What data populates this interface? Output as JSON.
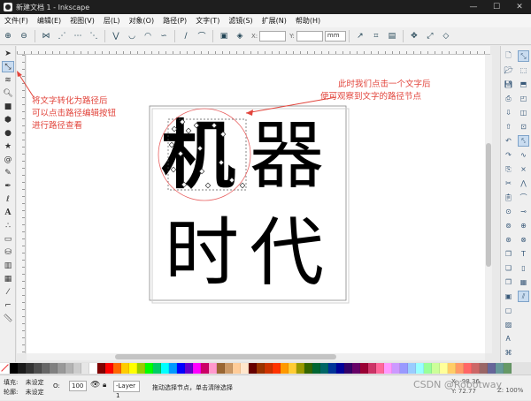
{
  "title": "新建文档 1 - Inkscape",
  "menus": [
    "文件(F)",
    "编辑(E)",
    "视图(V)",
    "层(L)",
    "对象(O)",
    "路径(P)",
    "文字(T)",
    "滤镜(S)",
    "扩展(N)",
    "帮助(H)"
  ],
  "controls": {
    "x_label": "X:",
    "y_label": "Y:",
    "x_value": "",
    "y_value": "",
    "unit": "mm"
  },
  "canvas": {
    "row1_char1": "机",
    "row1_char2": "器",
    "row2_char1": "时",
    "row2_char2": "代"
  },
  "annotations": {
    "left_note_line1": "将文字转化为路径后",
    "left_note_line2": "可以点击路径编辑按钮",
    "left_note_line3": "进行路径查看",
    "right_note_line1": "此时我们点击一个文字后",
    "right_note_line2": "便可观察到文字的路径节点",
    "accent_color": "#e2453c"
  },
  "status": {
    "fill_label": "填充:",
    "fill_value": "未设定",
    "stroke_label": "轮廓:",
    "stroke_value": "未设定",
    "opacity_label": "O:",
    "opacity_value": "100",
    "layer": "-Layer 1",
    "message": "拖动选择节点，单击清除选择",
    "coord_x": "X: -98.36",
    "coord_y": "Y: 72.77",
    "zoom": "Z: 100%"
  },
  "watermark": "CSDN @Robotway",
  "palette": [
    "#000000",
    "#1a1a1a",
    "#333333",
    "#4d4d4d",
    "#666666",
    "#808080",
    "#999999",
    "#b3b3b3",
    "#cccccc",
    "#e6e6e6",
    "#ffffff",
    "#800000",
    "#ff0000",
    "#ff6600",
    "#ffcc00",
    "#ffff00",
    "#99cc00",
    "#00ff00",
    "#00cc66",
    "#00ffff",
    "#0099ff",
    "#0000ff",
    "#6600cc",
    "#ff00ff",
    "#cc0066",
    "#ff99cc",
    "#996633",
    "#cc9966",
    "#ffcc99",
    "#ffe6cc",
    "#660000",
    "#993300",
    "#cc3300",
    "#ff3300",
    "#ff9900",
    "#ffcc33",
    "#999900",
    "#336600",
    "#006633",
    "#006666",
    "#003399",
    "#000099",
    "#330066",
    "#660066",
    "#990033",
    "#cc3366",
    "#ff6699",
    "#ff99ff",
    "#cc99ff",
    "#9999ff",
    "#99ccff",
    "#99ffff",
    "#99ff99",
    "#ccff99",
    "#ffff99",
    "#ffcc66",
    "#ff9966",
    "#ff6666",
    "#cc6666",
    "#996666",
    "#666699",
    "#669999",
    "#669966"
  ]
}
